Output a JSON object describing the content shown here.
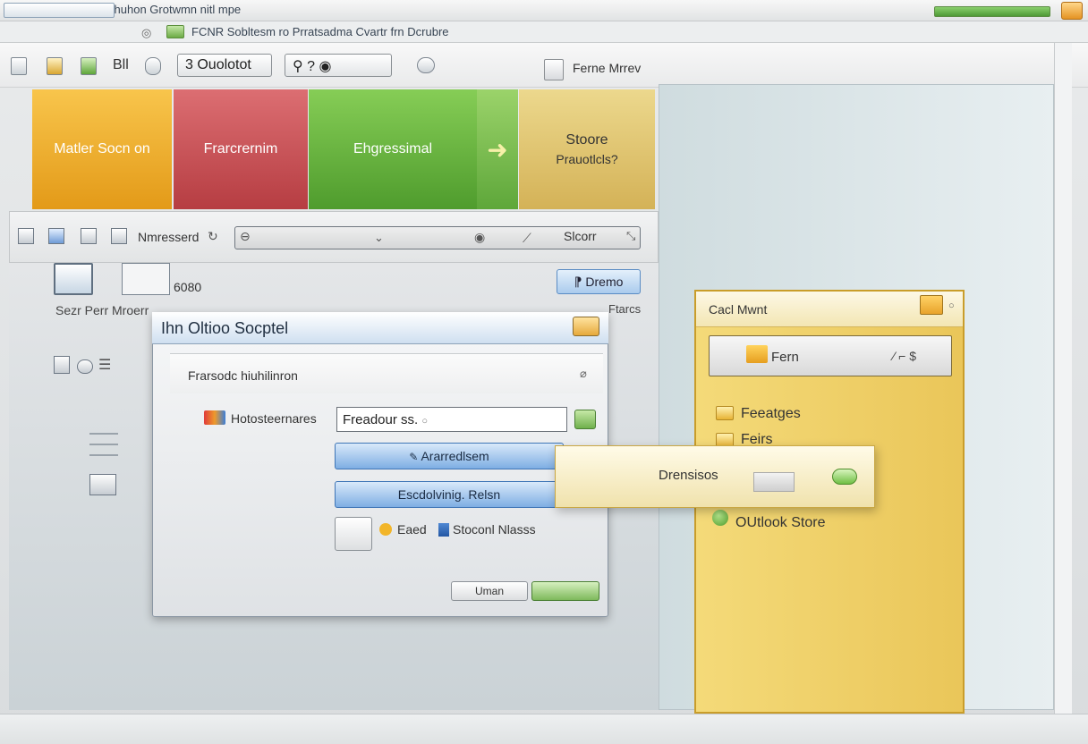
{
  "window": {
    "title": "Pront-Ontre ov Cotmthuhon Grotwmn nitl mpe",
    "address": "FCNR Sobltesm ro Prratsadma Cvartr frn Dcrubre"
  },
  "toolbar": {
    "edit_label": "Bll",
    "outlook_button": "Ouolotot",
    "outlook_number": "3",
    "help_button_text": "?",
    "right_label": "Ferne Mrrev"
  },
  "tiles": {
    "orange": "Matler Socn on",
    "red": "Frarcrernim",
    "green": "Ehgressimal",
    "tan_line1": "Stoore",
    "tan_line2": "Prauotlcls?"
  },
  "toolbar2": {
    "label": "Nmresserd",
    "store_label": "Slcorr"
  },
  "content": {
    "number": "6080",
    "scan_label": "Sezr Perr Mroerr",
    "button": "Dremo",
    "side_label": "Ftarcs"
  },
  "dialog": {
    "title": "Ihn Oltioo Socptel",
    "section_title": "Frarsodc hiuhilinron",
    "field_label": "Hotosteernares",
    "field_value": "Freadour ss.",
    "button1": "Ararredlsem",
    "button2": "Escdolvinig. Relsn",
    "check_label1": "Eaed",
    "check_label2": "Stoconl Nlasss",
    "cancel_button": "Uman"
  },
  "yellow_panel": {
    "title": "Cacl Mwnt",
    "search_value": "Fern",
    "items": [
      "Feeatges",
      "Feirs",
      "OUtlook Store"
    ]
  },
  "popup": {
    "label": "Drensisos"
  }
}
